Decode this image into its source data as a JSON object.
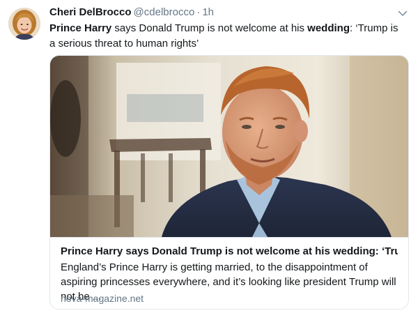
{
  "tweet": {
    "author": {
      "display_name": "Cheri DelBrocco",
      "handle": "@cdelbrocco"
    },
    "separator": "·",
    "time": "1h",
    "text": {
      "segments": [
        {
          "text": "Prince Harry",
          "bold": true
        },
        {
          "text": " says Donald Trump is not welcome at his ",
          "bold": false
        },
        {
          "text": "wedding",
          "bold": true
        },
        {
          "text": ": ‘Trump is a serious threat to human rights’",
          "bold": false
        }
      ]
    },
    "card": {
      "title": "Prince Harry says Donald Trump is not welcome at his wedding: ‘Tru...",
      "description": "England’s Prince Harry is getting married, to the disappointment of aspiring princesses everywhere, and it’s looking like president Trump will not be ...",
      "domain": "nova-magazine.net"
    }
  },
  "icons": {
    "caret": "chevron-down-icon"
  },
  "colors": {
    "text_primary": "#14171a",
    "text_secondary": "#657786",
    "border": "#e1e8ed",
    "caret": "#8899a6"
  }
}
